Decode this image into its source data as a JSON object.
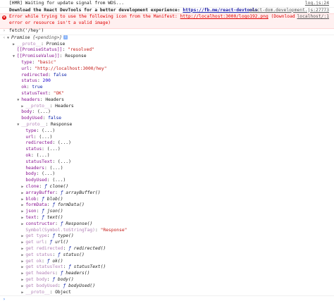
{
  "console": {
    "hmr": {
      "text": "[HMR] Waiting for update signal from WDS...",
      "source": "log.js:24"
    },
    "devtools": {
      "text_bold": "Download the React DevTools for a better development experience: ",
      "link": "https://fb.me/react-devtools",
      "source": "react-dom.development.js:27773"
    },
    "error": {
      "part1": "Error while trying to use the following icon from the Manifest: ",
      "link": "http://localhost:3000/logo192.png",
      "part2": " (Download",
      "line2": "error or resource isn't a valid image)",
      "source": "localhost/:1"
    },
    "command": {
      "text": "fetch('/hey')"
    },
    "result": {
      "label": "Promise",
      "pending": "{<pending>}",
      "info_glyph": "i"
    }
  },
  "tree": {
    "proto_key": "__proto__",
    "promise_proto_val": "Promise",
    "promise_status_key": "[[PromiseStatus]]",
    "promise_status_val": "\"resolved\"",
    "promise_value_key": "[[PromiseValue]]",
    "response_label": "Response",
    "type_key": "type",
    "type_val": "\"basic\"",
    "url_key": "url",
    "url_val": "\"http://localhost:3000/hey\"",
    "redirected_key": "redirected",
    "redirected_val": "false",
    "status_key": "status",
    "status_val": "200",
    "ok_key": "ok",
    "ok_val": "true",
    "statusText_key": "statusText",
    "statusText_val": "\"OK\"",
    "headers_key": "headers",
    "headers_val": "Headers",
    "headers_proto_val": "Headers",
    "body_key": "body",
    "bodyUsed_key": "bodyUsed",
    "bodyUsed_val": "false",
    "ellipsis": "(...)",
    "object_label": "Object",
    "proto_getters": [
      {
        "key": "type"
      },
      {
        "key": "url"
      },
      {
        "key": "redirected"
      },
      {
        "key": "status"
      },
      {
        "key": "ok"
      },
      {
        "key": "statusText"
      },
      {
        "key": "headers"
      },
      {
        "key": "body"
      },
      {
        "key": "bodyUsed"
      }
    ],
    "proto_methods": [
      {
        "key": "clone",
        "f": "ƒ",
        "sig": "clone()"
      },
      {
        "key": "arrayBuffer",
        "f": "ƒ",
        "sig": "arrayBuffer()"
      },
      {
        "key": "blob",
        "f": "ƒ",
        "sig": "blob()"
      },
      {
        "key": "formData",
        "f": "ƒ",
        "sig": "formData()"
      },
      {
        "key": "json",
        "f": "ƒ",
        "sig": "json()"
      },
      {
        "key": "text",
        "f": "ƒ",
        "sig": "text()"
      },
      {
        "key": "constructor",
        "f": "ƒ",
        "sig": "Response()"
      }
    ],
    "symbol_key": "Symbol(Symbol.toStringTag)",
    "symbol_val": "\"Response\"",
    "getters": [
      {
        "key": "get type",
        "f": "ƒ",
        "sig": "type()"
      },
      {
        "key": "get url",
        "f": "ƒ",
        "sig": "url()"
      },
      {
        "key": "get redirected",
        "f": "ƒ",
        "sig": "redirected()"
      },
      {
        "key": "get status",
        "f": "ƒ",
        "sig": "status()"
      },
      {
        "key": "get ok",
        "f": "ƒ",
        "sig": "ok()"
      },
      {
        "key": "get statusText",
        "f": "ƒ",
        "sig": "statusText()"
      },
      {
        "key": "get headers",
        "f": "ƒ",
        "sig": "headers()"
      },
      {
        "key": "get body",
        "f": "ƒ",
        "sig": "body()"
      },
      {
        "key": "get bodyUsed",
        "f": "ƒ",
        "sig": "bodyUsed()"
      }
    ],
    "expand_glyph": "▶",
    "collapse_glyph": "▼"
  },
  "prompt": {
    "glyph": "›"
  }
}
